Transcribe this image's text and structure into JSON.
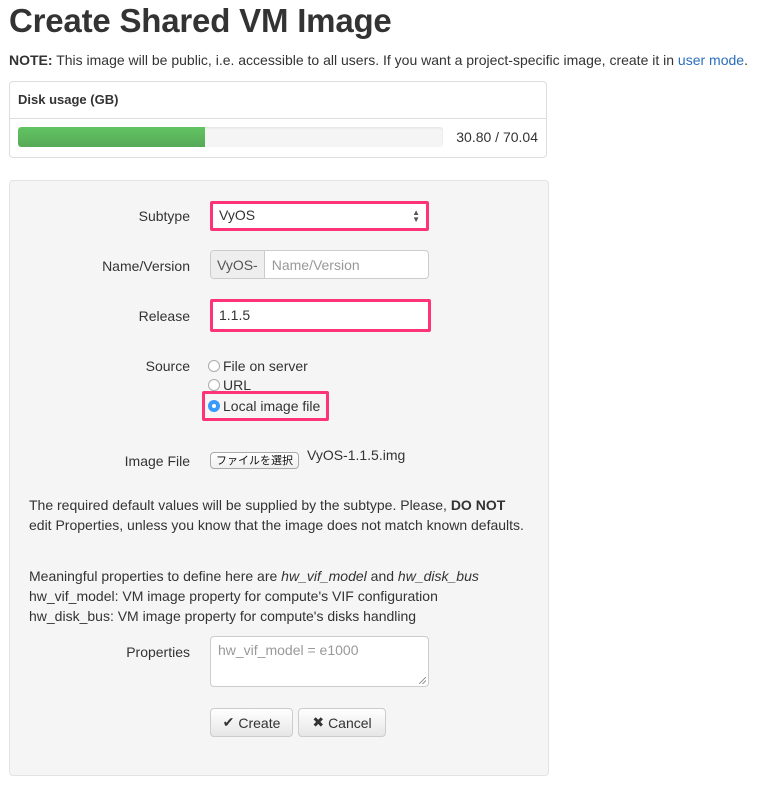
{
  "page": {
    "title": "Create Shared VM Image",
    "note_label": "NOTE:",
    "note_text": " This image will be public, i.e. accessible to all users. If you want a project-specific image, create it in ",
    "note_link": "user mode",
    "note_end": "."
  },
  "disk_usage": {
    "heading": "Disk usage (GB)",
    "used": 30.8,
    "total": 70.04,
    "value_text": "30.80 / 70.04",
    "fill_percent": 44,
    "bar_color": "#5cb85c"
  },
  "form": {
    "subtype": {
      "label": "Subtype",
      "value": "VyOS"
    },
    "name_version": {
      "label": "Name/Version",
      "prefix": "VyOS-",
      "placeholder": "Name/Version"
    },
    "release": {
      "label": "Release",
      "value": "1.1.5"
    },
    "source": {
      "label": "Source",
      "options": [
        {
          "label": "File on server",
          "checked": false
        },
        {
          "label": "URL",
          "checked": false
        },
        {
          "label": "Local image file",
          "checked": true
        }
      ]
    },
    "image_file": {
      "label": "Image File",
      "button_label": "ファイルを選択",
      "file_name": "VyOS-1.1.5.img"
    },
    "help1_pre": "The required default values will be supplied by the subtype. Please, ",
    "help1_bold": "DO NOT",
    "help1_post": " edit Properties, unless you know that the image does not match known defaults.",
    "help2_pre": "Meaningful properties to define here are ",
    "help2_em1": "hw_vif_model",
    "help2_mid": " and ",
    "help2_em2": "hw_disk_bus",
    "help3": "hw_vif_model: VM image property for compute's VIF configuration",
    "help4": "hw_disk_bus: VM image property for compute's disks handling",
    "properties": {
      "label": "Properties",
      "placeholder": "hw_vif_model = e1000"
    },
    "create_label": "Create",
    "cancel_label": "Cancel",
    "highlight_color": "#ff3377"
  }
}
